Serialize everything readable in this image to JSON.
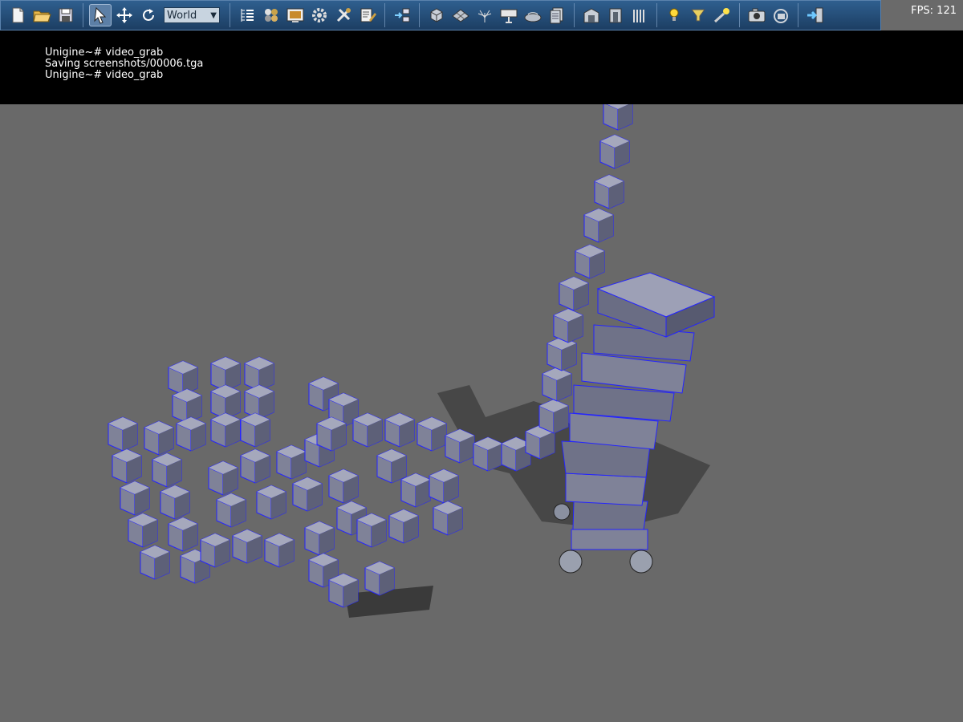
{
  "toolbar": {
    "buttons": [
      {
        "name": "new-file-icon"
      },
      {
        "name": "open-folder-icon"
      },
      {
        "name": "save-icon"
      },
      {
        "name": "select-pointer-icon"
      },
      {
        "name": "move-icon"
      },
      {
        "name": "rotate-icon"
      },
      {
        "name": "node-list-icon"
      },
      {
        "name": "materials-icon"
      },
      {
        "name": "textures-icon"
      },
      {
        "name": "settings-gear-icon"
      },
      {
        "name": "tools-icon"
      },
      {
        "name": "editor-script-icon"
      },
      {
        "name": "reference-icon"
      },
      {
        "name": "box-object-icon"
      },
      {
        "name": "mesh-object-icon"
      },
      {
        "name": "particles-icon"
      },
      {
        "name": "decal-icon"
      },
      {
        "name": "water-object-icon"
      },
      {
        "name": "panel-object-icon"
      },
      {
        "name": "world-sector-icon"
      },
      {
        "name": "portal-icon"
      },
      {
        "name": "occluder-icon"
      },
      {
        "name": "light-bulb-icon"
      },
      {
        "name": "spot-light-icon"
      },
      {
        "name": "sun-light-icon"
      },
      {
        "name": "camera-icon"
      },
      {
        "name": "player-camera-icon"
      },
      {
        "name": "exit-icon"
      }
    ],
    "coordinate_space": {
      "selected": "World"
    }
  },
  "fps": {
    "text": "FPS: 121"
  },
  "console": {
    "lines": [
      "Unigine~# video_grab",
      "Saving screenshots/00006.tga",
      "Unigine~# video_grab"
    ]
  },
  "viewport": {
    "description_colors": {
      "ground": "#696969",
      "cube_face": "#7c7e96",
      "cube_edge": "#1a1aff"
    }
  }
}
